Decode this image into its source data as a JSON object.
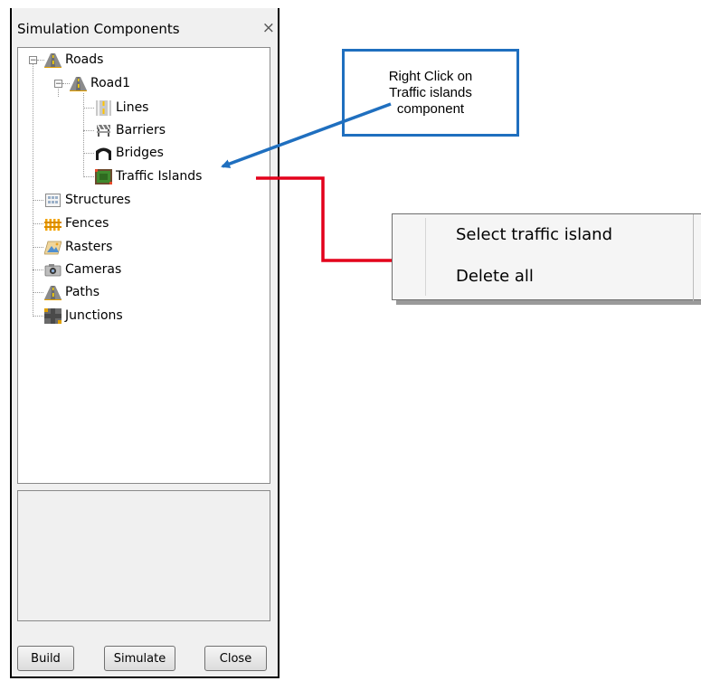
{
  "panel": {
    "title": "Simulation Components",
    "close_label": "×",
    "buttons": {
      "build": "Build",
      "simulate": "Simulate",
      "close": "Close"
    }
  },
  "tree": {
    "roads": "Roads",
    "road1": "Road1",
    "lines": "Lines",
    "barriers": "Barriers",
    "bridges": "Bridges",
    "traffic_islands": "Traffic Islands",
    "structures": "Structures",
    "fences": "Fences",
    "rasters": "Rasters",
    "cameras": "Cameras",
    "paths": "Paths",
    "junctions": "Junctions",
    "expander_symbol": "−"
  },
  "callout": {
    "line1": "Right Click on",
    "line2": "Traffic islands",
    "line3": "component"
  },
  "context_menu": {
    "items": [
      "Select traffic island",
      "Delete all"
    ]
  },
  "colors": {
    "callout_border": "#1f6fbf",
    "arrow_blue": "#1f6fbf",
    "connector_red": "#e3001b"
  }
}
